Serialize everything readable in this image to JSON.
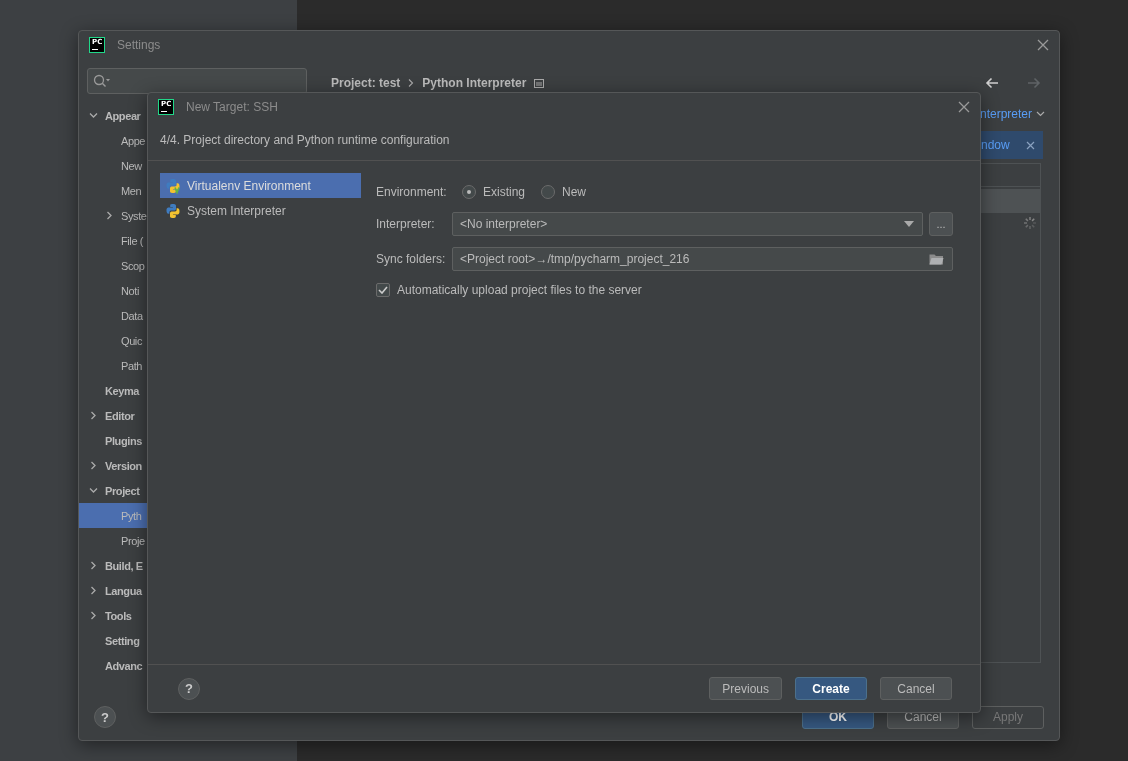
{
  "settings": {
    "logo": "PC",
    "title": "Settings",
    "tree": [
      {
        "label": "Appear",
        "expanded": true,
        "selected": false,
        "children": [
          {
            "label": "Appe",
            "selected": false
          },
          {
            "label": "New",
            "selected": false
          },
          {
            "label": "Men",
            "selected": false
          },
          {
            "label": "Syste",
            "expanded": false,
            "selected": false
          },
          {
            "label": "File (",
            "selected": false
          },
          {
            "label": "Scop",
            "selected": false
          },
          {
            "label": "Noti",
            "selected": false
          },
          {
            "label": "Data",
            "selected": false
          },
          {
            "label": "Quic",
            "selected": false
          },
          {
            "label": "Path",
            "selected": false
          }
        ]
      },
      {
        "label": "Keyma",
        "selected": false
      },
      {
        "label": "Editor",
        "expanded": false,
        "selected": false
      },
      {
        "label": "Plugins",
        "selected": false
      },
      {
        "label": "Version",
        "expanded": false,
        "selected": false
      },
      {
        "label": "Project",
        "expanded": true,
        "selected": false,
        "children": [
          {
            "label": "Pyth",
            "selected": true
          },
          {
            "label": "Proje",
            "selected": false
          }
        ]
      },
      {
        "label": "Build, E",
        "expanded": false,
        "selected": false
      },
      {
        "label": "Langua",
        "expanded": false,
        "selected": false
      },
      {
        "label": "Tools",
        "expanded": false,
        "selected": false
      },
      {
        "label": "Setting",
        "selected": false
      },
      {
        "label": "Advanc",
        "selected": false
      }
    ],
    "help": "?",
    "breadcrumb": [
      "Project: test",
      "Python Interpreter"
    ],
    "interpreter_link": "nterpreter",
    "banner": "ndow",
    "buttons": [
      {
        "label": "OK",
        "kind": "primary",
        "disabled": false
      },
      {
        "label": "Cancel",
        "kind": "normal",
        "disabled": false
      },
      {
        "label": "Apply",
        "kind": "normal",
        "disabled": true
      }
    ]
  },
  "dialog": {
    "logo": "PC",
    "title": "New Target: SSH",
    "help": "?",
    "step": "4/4. Project directory and Python runtime configuration",
    "environments": [
      {
        "label": "Virtualenv Environment",
        "kind": "virtualenv",
        "selected": true
      },
      {
        "label": "System Interpreter",
        "kind": "system",
        "selected": false
      }
    ],
    "environment": {
      "label": "Environment:",
      "options": [
        {
          "label": "Existing",
          "selected": true
        },
        {
          "label": "New",
          "selected": false
        }
      ]
    },
    "interpreter": {
      "label": "Interpreter:",
      "value": "<No interpreter>",
      "browse": "..."
    },
    "sync_folders": {
      "label": "Sync folders:",
      "value": "<Project root>→/tmp/pycharm_project_216"
    },
    "auto_upload": {
      "label": "Automatically upload project files to the server",
      "checked": true
    },
    "buttons": [
      {
        "label": "Previous",
        "kind": "normal"
      },
      {
        "label": "Create",
        "kind": "primary"
      },
      {
        "label": "Cancel",
        "kind": "normal"
      }
    ]
  }
}
